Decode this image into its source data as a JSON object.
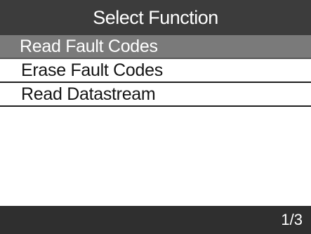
{
  "header": {
    "title": "Select Function"
  },
  "menu": {
    "selected_index": 0,
    "items": [
      {
        "label": "Read Fault Codes"
      },
      {
        "label": "Erase Fault Codes"
      },
      {
        "label": "Read Datastream"
      }
    ]
  },
  "footer": {
    "page_indicator": "1/3"
  },
  "colors": {
    "title_bar_bg": "#3c3c3c",
    "selected_item_bg": "#7a7a7a",
    "status_bar_bg": "#2f2f2f",
    "screen_bg": "#ffffff"
  }
}
